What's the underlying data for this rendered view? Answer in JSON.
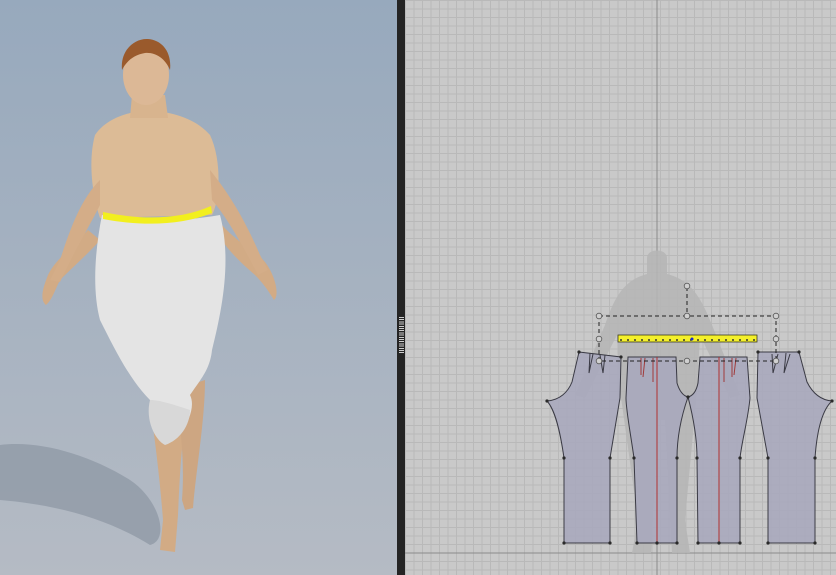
{
  "window": {
    "panels": [
      "3d-view",
      "2d-pattern-view"
    ]
  },
  "colors": {
    "background_3d": "#a6b3c2",
    "background_2d": "#c9c9c9",
    "pattern_fill": "#a9a9bc",
    "selection_highlight": "#f4f02a",
    "grainline": "#b03030",
    "garment": "#e6e6e6",
    "skin": "#d8b48e"
  }
}
